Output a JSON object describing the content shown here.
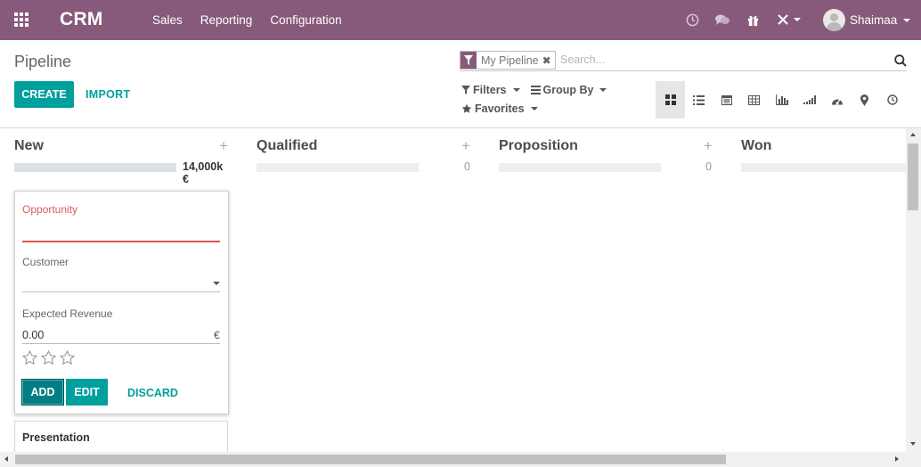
{
  "navbar": {
    "brand": "CRM",
    "menu": [
      "Sales",
      "Reporting",
      "Configuration"
    ],
    "user_name": "Shaimaa",
    "colors": {
      "bar": "#875a7b"
    }
  },
  "control": {
    "breadcrumb": "Pipeline",
    "create_label": "CREATE",
    "import_label": "IMPORT",
    "search": {
      "facet": "My Pipeline",
      "placeholder": "Search..."
    },
    "filters_label": "Filters",
    "groupby_label": "Group By",
    "favorites_label": "Favorites",
    "views": [
      "kanban-icon",
      "list-icon",
      "calendar-icon",
      "pivot-icon",
      "graph-icon",
      "cohort-icon",
      "dashboard-icon",
      "map-icon",
      "activity-icon"
    ]
  },
  "kanban": {
    "columns": [
      {
        "title": "New",
        "amount": "14,000k €",
        "plus": "+"
      },
      {
        "title": "Qualified",
        "amount": "0",
        "plus": "+"
      },
      {
        "title": "Proposition",
        "amount": "0",
        "plus": "+"
      },
      {
        "title": "Won",
        "amount": "",
        "plus": ""
      }
    ],
    "quick_create": {
      "opportunity_label": "Opportunity",
      "customer_label": "Customer",
      "revenue_label": "Expected Revenue",
      "revenue_value": "0.00",
      "currency": "€",
      "add_label": "ADD",
      "edit_label": "EDIT",
      "discard_label": "DISCARD"
    },
    "cards": [
      {
        "title": "Presentation"
      }
    ]
  }
}
